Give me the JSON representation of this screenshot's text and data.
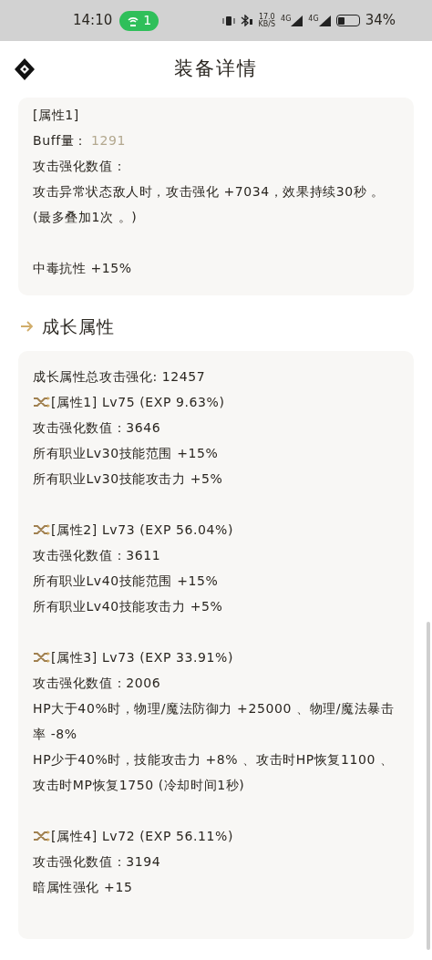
{
  "status_bar": {
    "time": "14:10",
    "hotspot_count": "1",
    "speed": "17.0",
    "speed_unit": "KB/S",
    "sim1": "4G",
    "sim2": "4G",
    "battery": "34%"
  },
  "header": {
    "title": "装备详情"
  },
  "effect_card": {
    "paragraphs": [
      {
        "lines": [
          {
            "kind": "text",
            "text": "[属性1]"
          },
          {
            "kind": "buff",
            "label": "Buff量：",
            "value": "1291"
          },
          {
            "kind": "text",
            "text": "攻击强化数值："
          },
          {
            "kind": "text",
            "text": "攻击异常状态敌人时，攻击强化 +7034，效果持续30秒 。"
          },
          {
            "kind": "text",
            "text": "(最多叠加1次 。)"
          }
        ]
      },
      {
        "lines": [
          {
            "kind": "text",
            "text": "中毒抗性 +15%"
          }
        ]
      }
    ]
  },
  "growth_section": {
    "title": "成长属性",
    "total": "成长属性总攻击强化: 12457",
    "groups": [
      {
        "header": "[属性1] Lv75 (EXP 9.63%)",
        "lines": [
          "攻击强化数值：3646",
          "所有职业Lv30技能范围 +15%",
          "所有职业Lv30技能攻击力 +5%"
        ]
      },
      {
        "header": "[属性2] Lv73 (EXP 56.04%)",
        "lines": [
          "攻击强化数值：3611",
          "所有职业Lv40技能范围 +15%",
          "所有职业Lv40技能攻击力 +5%"
        ]
      },
      {
        "header": "[属性3] Lv73 (EXP 33.91%)",
        "lines": [
          "攻击强化数值：2006",
          "HP大于40%时，物理/魔法防御力 +25000 、物理/魔法暴击率 -8%",
          "HP少于40%时，技能攻击力 +8% 、攻击时HP恢复1100 、攻击时MP恢复1750 (冷却时间1秒)"
        ]
      },
      {
        "header": "[属性4] Lv72 (EXP 56.11%)",
        "lines": [
          "攻击强化数值：3194",
          "暗属性强化 +15"
        ]
      }
    ]
  }
}
